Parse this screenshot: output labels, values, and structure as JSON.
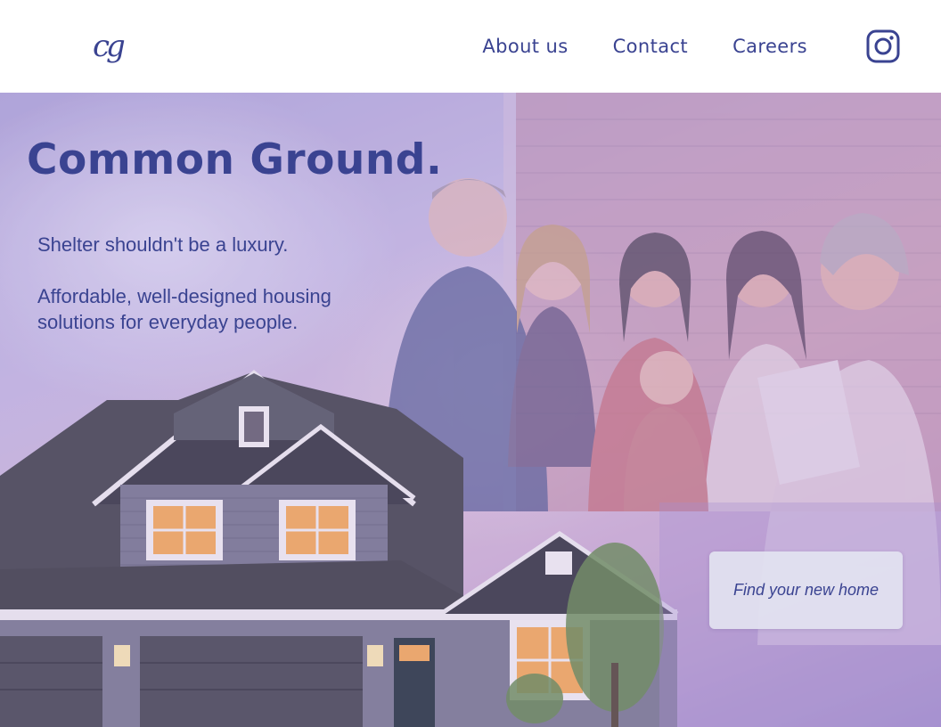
{
  "header": {
    "logo_text": "cg",
    "nav": [
      {
        "label": "About us"
      },
      {
        "label": "Contact"
      },
      {
        "label": "Careers"
      }
    ],
    "social_icon": "instagram-icon"
  },
  "hero": {
    "title": "Common Ground.",
    "tagline": "Shelter shouldn't be a luxury.",
    "description": "Affordable, well-designed housing solutions for everyday people.",
    "cta_label": "Find your new home"
  },
  "colors": {
    "brand": "#3a4391",
    "hero_tint": "#b8a8e0",
    "cta_background": "#e2e2f0"
  }
}
